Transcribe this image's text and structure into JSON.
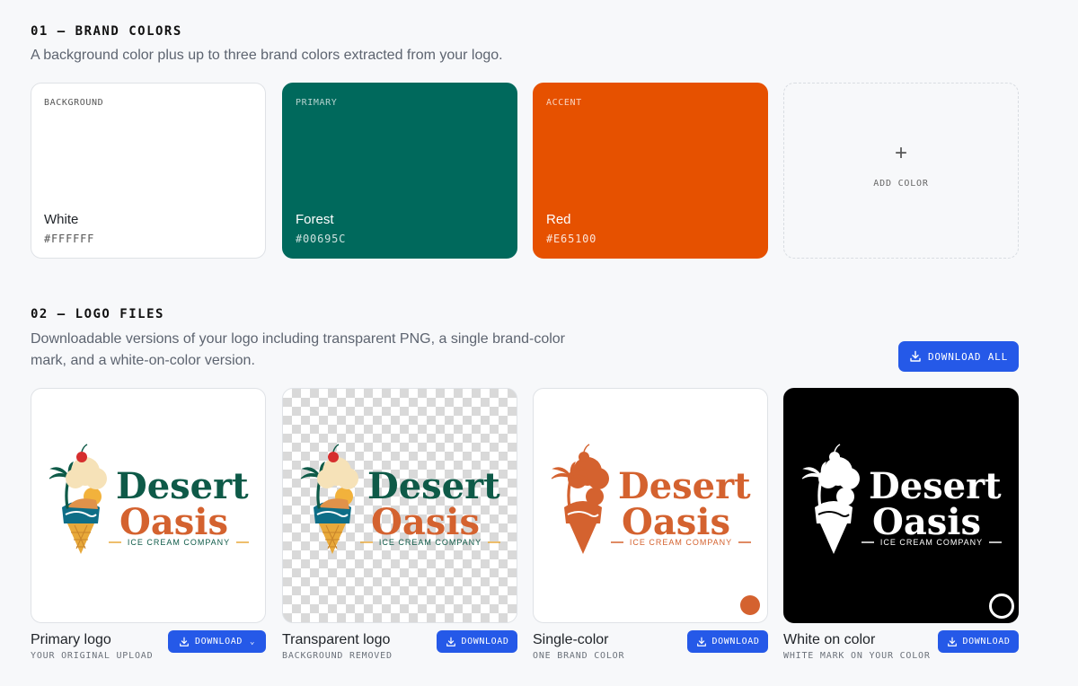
{
  "brand_colors": {
    "title": "01 — BRAND COLORS",
    "description": "A background color plus up to three brand colors extracted from your logo.",
    "swatches": [
      {
        "role": "BACKGROUND",
        "name": "White",
        "hex": "#FFFFFF",
        "bg": "#FFFFFF",
        "text_color": "#1f2328"
      },
      {
        "role": "PRIMARY",
        "name": "Forest",
        "hex": "#00695C",
        "bg": "#00695C",
        "text_color": "#FFFFFF"
      },
      {
        "role": "ACCENT",
        "name": "Red",
        "hex": "#E65100",
        "bg": "#E65100",
        "text_color": "#FFFFFF"
      }
    ],
    "add_label": "ADD COLOR",
    "add_icon": "plus-icon"
  },
  "logo_files": {
    "title": "02 — LOGO FILES",
    "description": "Downloadable versions of your logo including transparent PNG, a single brand-color mark, and a white-on-color version.",
    "download_all_label": "DOWNLOAD ALL",
    "download_icon": "download-icon",
    "logo_text": {
      "line1": "Desert",
      "line2": "Oasis",
      "tagline": "ICE CREAM COMPANY"
    },
    "cards": [
      {
        "name": "Primary logo",
        "sub": "YOUR ORIGINAL UPLOAD",
        "button": "DOWNLOAD",
        "has_dropdown": true
      },
      {
        "name": "Transparent logo",
        "sub": "BACKGROUND REMOVED",
        "button": "DOWNLOAD"
      },
      {
        "name": "Single-color",
        "sub": "ONE BRAND COLOR",
        "button": "DOWNLOAD",
        "indicator_color": "#D4622F"
      },
      {
        "name": "White on color",
        "sub": "WHITE MARK ON YOUR COLOR",
        "button": "DOWNLOAD"
      }
    ]
  },
  "colors": {
    "button_blue": "#2559E8",
    "logo_green": "#0E5A48",
    "logo_orange": "#D4622F",
    "logo_gold": "#E8A93A"
  }
}
